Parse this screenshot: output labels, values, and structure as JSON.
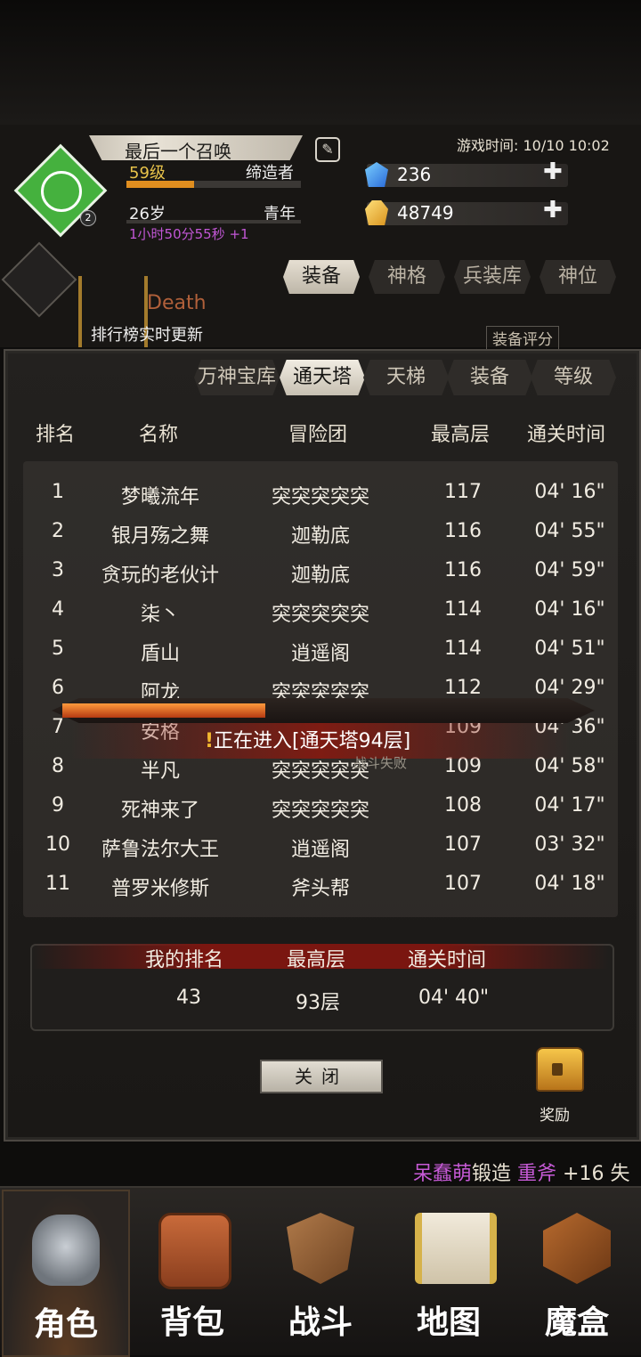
{
  "header": {
    "player_name": "最后一个召唤",
    "level": "59级",
    "level_progress": 0.39,
    "title": "缔造者",
    "age": "26岁",
    "stage": "青年",
    "timer": "1小时50分55秒 +1",
    "avatar_badge": "2",
    "game_time": "游戏时间: 10/10 10:02",
    "blue_gems": "236",
    "gold": "48749"
  },
  "main_tabs": [
    "装备",
    "神格",
    "兵装库",
    "神位"
  ],
  "main_tab_active": "装备",
  "background_texts": {
    "death": "Death",
    "rank_live": "排行榜实时更新",
    "score_label": "装备评分"
  },
  "ranking": {
    "tabs": [
      "万神宝库",
      "通天塔",
      "天梯",
      "装备",
      "等级"
    ],
    "active_tab": "通天塔",
    "columns": [
      "排名",
      "名称",
      "冒险团",
      "最高层",
      "通关时间"
    ],
    "rows": [
      {
        "rank": "1",
        "name": "梦曦流年",
        "guild": "突突突突突",
        "floor": "117",
        "time": "04' 16\""
      },
      {
        "rank": "2",
        "name": "银月殇之舞",
        "guild": "迦勒底",
        "floor": "116",
        "time": "04' 55\""
      },
      {
        "rank": "3",
        "name": "贪玩的老伙计",
        "guild": "迦勒底",
        "floor": "116",
        "time": "04' 59\""
      },
      {
        "rank": "4",
        "name": "柒丶",
        "guild": "突突突突突",
        "floor": "114",
        "time": "04' 16\""
      },
      {
        "rank": "5",
        "name": "盾山",
        "guild": "逍遥阁",
        "floor": "114",
        "time": "04' 51\""
      },
      {
        "rank": "6",
        "name": "阿龙",
        "guild": "突突突突突",
        "floor": "112",
        "time": "04' 29\""
      },
      {
        "rank": "7",
        "name": "安格",
        "guild": "",
        "floor": "109",
        "time": "04' 36\""
      },
      {
        "rank": "8",
        "name": "半凡",
        "guild": "突突突突突",
        "floor": "109",
        "time": "04' 58\""
      },
      {
        "rank": "9",
        "name": "死神来了",
        "guild": "突突突突突",
        "floor": "108",
        "time": "04' 17\""
      },
      {
        "rank": "10",
        "name": "萨鲁法尔大王",
        "guild": "逍遥阁",
        "floor": "107",
        "time": "03' 32\""
      },
      {
        "rank": "11",
        "name": "普罗米修斯",
        "guild": "斧头帮",
        "floor": "107",
        "time": "04' 18\""
      }
    ],
    "mine": {
      "label_rank": "我的排名",
      "label_floor": "最高层",
      "label_time": "通关时间",
      "rank": "43",
      "floor": "93层",
      "time": "04' 40\""
    },
    "close_label": "关闭",
    "reward_label": "奖励"
  },
  "loading": {
    "progress": 0.38,
    "bang": "!",
    "text": "正在进入[通天塔94层]",
    "sub": "战斗失败"
  },
  "ticker": {
    "player": "呆蠢萌",
    "action": "锻造",
    "item": "重斧",
    "suffix": "+16 失"
  },
  "nav": [
    {
      "label": "角色",
      "icon": "helmet-icon",
      "active": true
    },
    {
      "label": "背包",
      "icon": "backpack-icon",
      "active": false
    },
    {
      "label": "战斗",
      "icon": "sword-shield-icon",
      "active": false
    },
    {
      "label": "地图",
      "icon": "scroll-map-icon",
      "active": false
    },
    {
      "label": "魔盒",
      "icon": "magic-box-icon",
      "active": false
    }
  ]
}
